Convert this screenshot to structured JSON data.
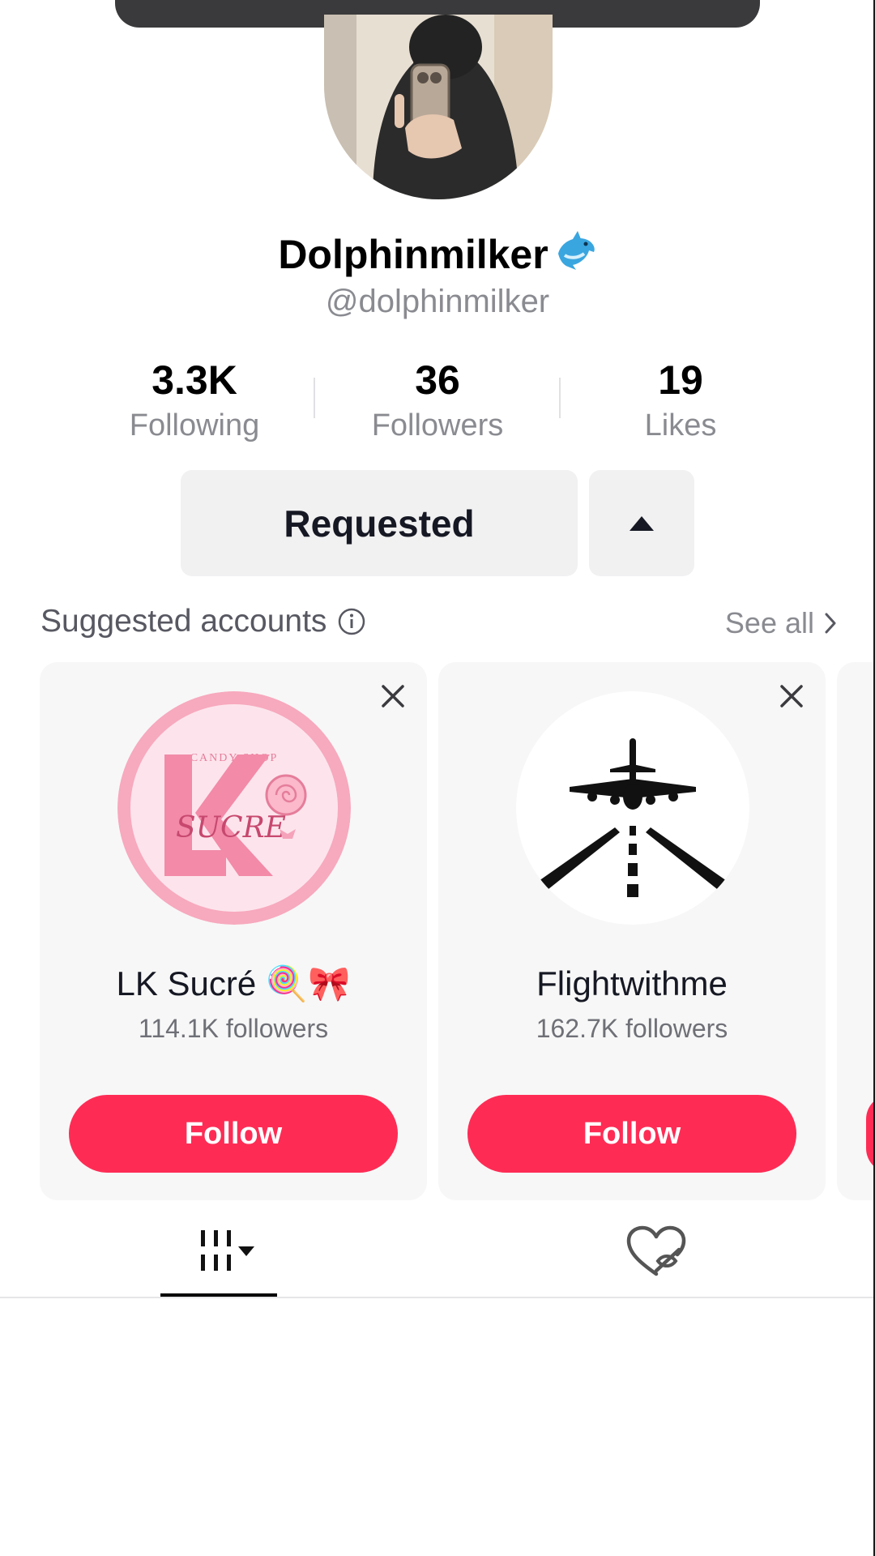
{
  "profile": {
    "display_name": "Dolphinmilker",
    "handle": "@dolphinmilker",
    "name_emoji_icon": "dolphin-icon"
  },
  "stats": [
    {
      "value": "3.3K",
      "label": "Following"
    },
    {
      "value": "36",
      "label": "Followers"
    },
    {
      "value": "19",
      "label": "Likes"
    }
  ],
  "actions": {
    "requested_label": "Requested",
    "dropdown_icon": "caret-up-icon"
  },
  "suggested": {
    "title": "Suggested accounts",
    "see_all_label": "See all",
    "accounts": [
      {
        "name": "LK Sucré 🍭🎀",
        "followers": "114.1K followers",
        "follow_label": "Follow",
        "logo_text_top": "CANDY SHOP",
        "logo_text_script": "SUCRE"
      },
      {
        "name": "Flightwithme",
        "followers": "162.7K followers",
        "follow_label": "Follow"
      }
    ]
  },
  "tabs": {
    "videos_icon": "grid-icon",
    "liked_icon": "liked-hidden-icon"
  },
  "colors": {
    "accent": "#fe2c55",
    "button_bg": "#f1f1f2",
    "muted_text": "#8a8b91"
  }
}
